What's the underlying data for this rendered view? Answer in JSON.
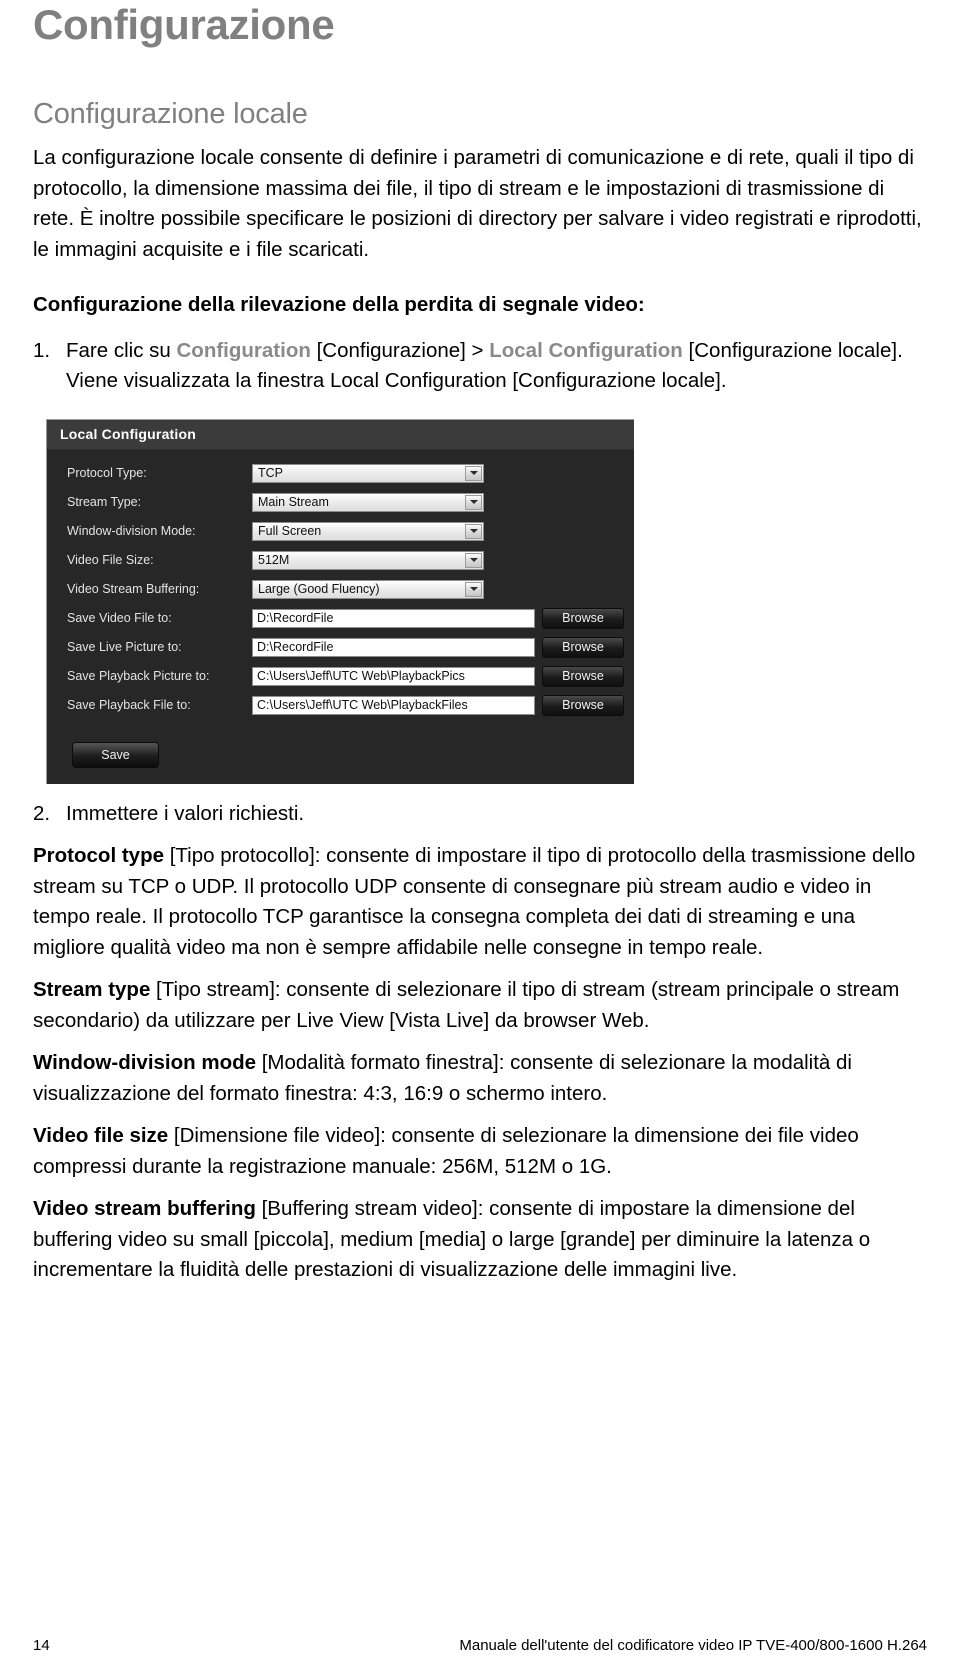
{
  "document": {
    "title": "Configurazione",
    "section_title": "Configurazione locale",
    "intro_paragraph": "La configurazione locale consente di definire i parametri di comunicazione e di rete, quali il tipo di protocollo, la dimensione massima dei file, il tipo di stream e le impostazioni di trasmissione di rete. È inoltre possibile specificare le posizioni di directory per salvare i video registrati e riprodotti, le immagini acquisite e i file scaricati.",
    "sub_heading": "Configurazione della rilevazione della perdita di segnale video:"
  },
  "steps": [
    {
      "marker": "1.",
      "part1": "Fare clic su ",
      "term1": "Configuration",
      "part2": " [Configurazione] > ",
      "term2": "Local Configuration",
      "part3": " [Configurazione locale]. Viene visualizzata la finestra Local Configuration [Configurazione locale]."
    },
    {
      "marker": "2.",
      "text": "Immettere i valori richiesti."
    }
  ],
  "descriptions": [
    {
      "term": "Protocol type",
      "text": " [Tipo protocollo]: consente di impostare il tipo di protocollo della trasmissione dello stream su TCP o UDP. Il protocollo UDP consente di consegnare più stream audio e video in tempo reale. Il protocollo TCP garantisce la consegna completa dei dati di streaming e una migliore qualità video ma non è sempre affidabile nelle consegne in tempo reale."
    },
    {
      "term": "Stream type",
      "text": " [Tipo stream]: consente di selezionare il tipo di stream (stream principale o stream secondario) da utilizzare per Live View [Vista Live] da browser Web."
    },
    {
      "term": "Window-division mode",
      "text": " [Modalità formato finestra]: consente di selezionare la modalità di visualizzazione del formato finestra: 4:3, 16:9 o schermo intero."
    },
    {
      "term": "Video file size",
      "text": " [Dimensione file video]: consente di selezionare la dimensione dei file video compressi durante la registrazione manuale: 256M, 512M o 1G."
    },
    {
      "term": "Video stream buffering",
      "text": " [Buffering stream video]: consente di impostare la dimensione del buffering video su small [piccola], medium [media] o large [grande] per diminuire la latenza o incrementare la fluidità delle prestazioni di visualizzazione delle immagini live."
    }
  ],
  "screenshot": {
    "panel_title": "Local Configuration",
    "selects": [
      {
        "label": "Protocol Type:",
        "value": "TCP"
      },
      {
        "label": "Stream Type:",
        "value": "Main Stream"
      },
      {
        "label": "Window-division Mode:",
        "value": "Full Screen"
      },
      {
        "label": "Video File Size:",
        "value": "512M"
      },
      {
        "label": "Video Stream Buffering:",
        "value": "Large (Good Fluency)"
      }
    ],
    "paths": [
      {
        "label": "Save Video File to:",
        "value": "D:\\RecordFile",
        "browse": "Browse"
      },
      {
        "label": "Save Live Picture to:",
        "value": "D:\\RecordFile",
        "browse": "Browse"
      },
      {
        "label": "Save Playback Picture to:",
        "value": "C:\\Users\\Jeff\\UTC Web\\PlaybackPics",
        "browse": "Browse"
      },
      {
        "label": "Save Playback File to:",
        "value": "C:\\Users\\Jeff\\UTC Web\\PlaybackFiles",
        "browse": "Browse"
      }
    ],
    "save_label": "Save"
  },
  "footer": {
    "page_number": "14",
    "doc_reference": "Manuale dell'utente del codificatore video IP TVE-400/800-1600 H.264"
  },
  "colors": {
    "heading_gray": "#808080",
    "ui_term_gray": "#8a8a8a",
    "panel_bg": "#272727",
    "panel_header_bg": "#3b3b3b"
  }
}
